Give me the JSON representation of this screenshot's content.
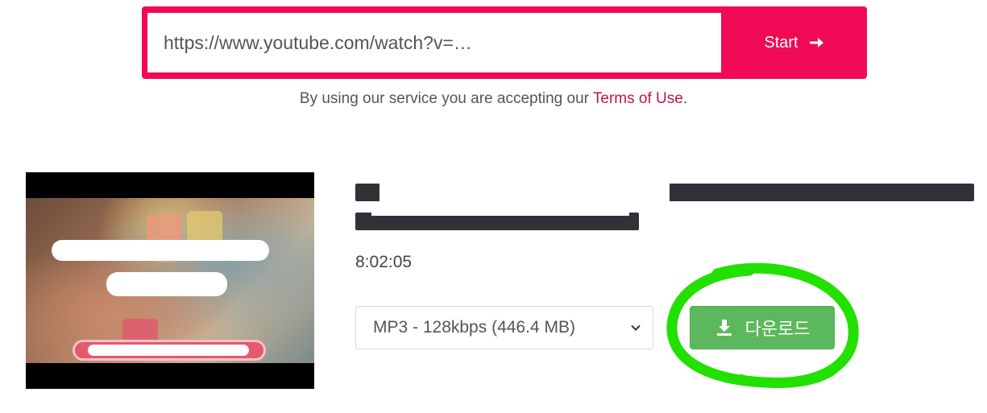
{
  "search": {
    "url_value": "https://www.youtube.com/watch?v=…",
    "start_label": "Start"
  },
  "terms": {
    "prefix": "By using our service you are accepting our ",
    "link_label": "Terms of Use",
    "suffix": "."
  },
  "video": {
    "duration": "8:02:05"
  },
  "download": {
    "format_selected": "MP3 - 128kbps (446.4 MB)",
    "button_label": "다운로드"
  },
  "colors": {
    "brand": "#f00a55",
    "download_green": "#5cb85c",
    "annotation_green": "#22e000"
  },
  "icons": {
    "start": "arrow-right-icon",
    "download": "download-icon",
    "select": "chevron-down-icon"
  }
}
